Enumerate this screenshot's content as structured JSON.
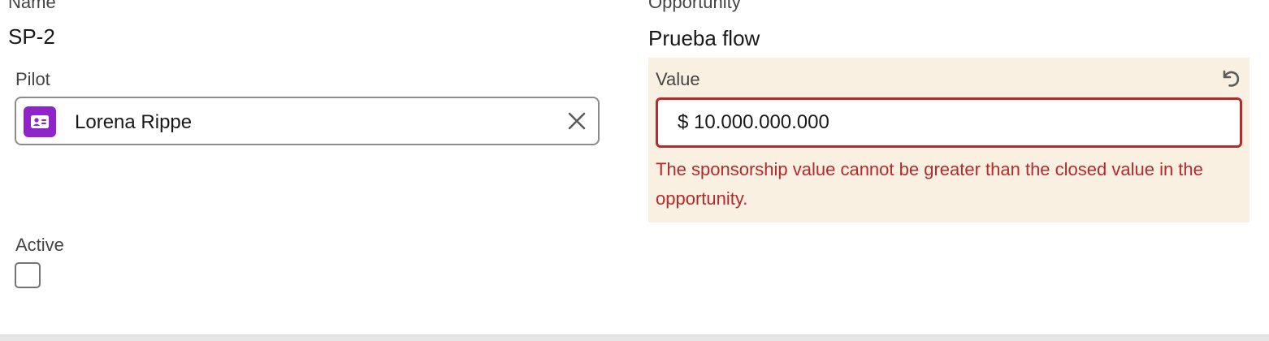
{
  "form": {
    "name": {
      "label": "Name",
      "value": "SP-2"
    },
    "opportunity": {
      "label": "Opportunity",
      "value": "Prueba flow"
    },
    "pilot": {
      "label": "Pilot",
      "selected": "Lorena Rippe",
      "entity_icon": "contact-card-icon",
      "clear_icon": "close-icon"
    },
    "value": {
      "label": "Value",
      "input_value": "$ 10.000.000.000",
      "error": "The sponsorship value cannot be greater than the closed value in the opportunity.",
      "undo_icon": "undo-icon",
      "edited_highlight_color": "#faf0e1",
      "error_color": "#b52a2a"
    },
    "active": {
      "label": "Active",
      "checked": false
    }
  },
  "colors": {
    "entity_icon_bg": "#8e24c9"
  }
}
